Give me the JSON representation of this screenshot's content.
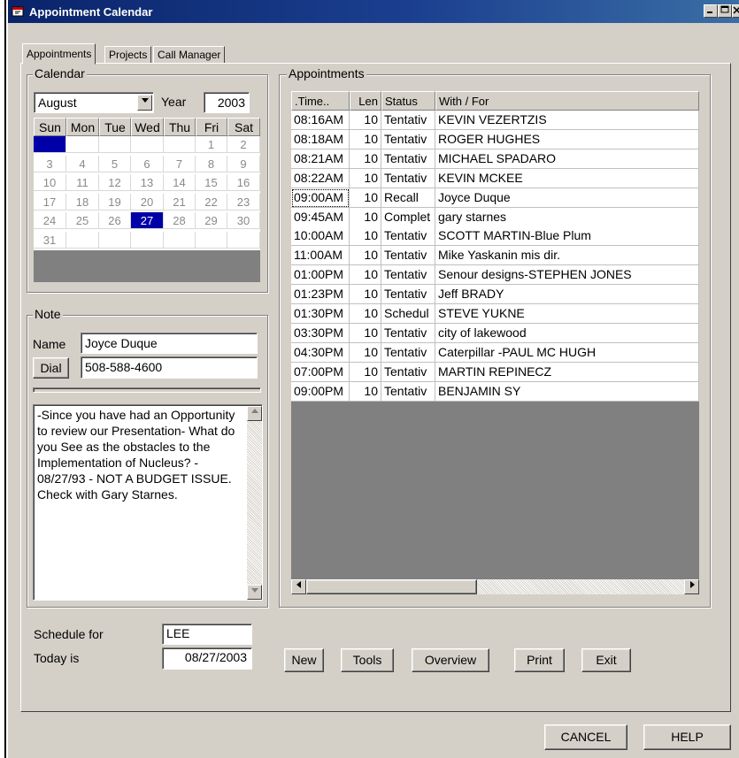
{
  "window": {
    "title": "Appointment Calendar"
  },
  "tabs": [
    {
      "label": "Appointments"
    },
    {
      "label": "Projects"
    },
    {
      "label": "Call Manager"
    }
  ],
  "calendar": {
    "group_label": "Calendar",
    "month": "August",
    "year_label": "Year",
    "year": "2003",
    "weekdays": [
      "Sun",
      "Mon",
      "Tue",
      "Wed",
      "Thu",
      "Fri",
      "Sat"
    ],
    "days": [
      [
        "",
        "",
        "",
        "",
        "",
        "1",
        "2"
      ],
      [
        "3",
        "4",
        "5",
        "6",
        "7",
        "8",
        "9"
      ],
      [
        "10",
        "11",
        "12",
        "13",
        "14",
        "15",
        "16"
      ],
      [
        "17",
        "18",
        "19",
        "20",
        "21",
        "22",
        "23"
      ],
      [
        "24",
        "25",
        "26",
        "27",
        "28",
        "29",
        "30"
      ],
      [
        "31",
        "",
        "",
        "",
        "",
        "",
        ""
      ]
    ],
    "selected_day": "27"
  },
  "note": {
    "group_label": "Note",
    "name_label": "Name",
    "name": "Joyce Duque",
    "dial_label": "Dial",
    "phone": "508-588-4600",
    "text": "-Since you have had an Opportunity to review our Presentation- What do you See as the obstacles to the Implementation of Nucleus? - 08/27/93 - NOT A BUDGET ISSUE. Check with Gary Starnes."
  },
  "appointments": {
    "group_label": "Appointments",
    "columns": [
      ".Time..",
      "Len",
      "Status",
      "With / For"
    ],
    "rows": [
      [
        "08:16AM",
        "10",
        "Tentativ",
        "KEVIN VEZERTZIS"
      ],
      [
        "08:18AM",
        "10",
        "Tentativ",
        "ROGER HUGHES"
      ],
      [
        "08:21AM",
        "10",
        "Tentativ",
        "MICHAEL SPADARO"
      ],
      [
        "08:22AM",
        "10",
        "Tentativ",
        "KEVIN MCKEE"
      ],
      [
        "09:00AM",
        "10",
        "Recall",
        "Joyce Duque"
      ],
      [
        "09:45AM",
        "10",
        "Complet",
        "gary starnes"
      ],
      [
        "10:00AM",
        "10",
        "Tentativ",
        "SCOTT MARTIN-Blue Plum"
      ],
      [
        "11:00AM",
        "10",
        "Tentativ",
        "Mike Yaskanin mis dir."
      ],
      [
        "01:00PM",
        "10",
        "Tentativ",
        "Senour designs-STEPHEN JONES"
      ],
      [
        "01:23PM",
        "10",
        "Tentativ",
        "Jeff BRADY"
      ],
      [
        "01:30PM",
        "10",
        "Schedul",
        "STEVE YUKNE"
      ],
      [
        "03:30PM",
        "10",
        "Tentativ",
        "city of lakewood"
      ],
      [
        "04:30PM",
        "10",
        "Tentativ",
        "Caterpillar -PAUL MC HUGH"
      ],
      [
        "07:00PM",
        "10",
        "Tentativ",
        "MARTIN REPINECZ"
      ],
      [
        "09:00PM",
        "10",
        "Tentativ",
        "BENJAMIN SY"
      ]
    ],
    "focused_row": 4
  },
  "footer": {
    "schedule_for_label": "Schedule for",
    "schedule_for": "LEE",
    "today_label": "Today is",
    "today": "08/27/2003",
    "buttons": {
      "new": "New",
      "tools": "Tools",
      "overview": "Overview",
      "print": "Print",
      "exit": "Exit"
    }
  },
  "dialog": {
    "cancel": "CANCEL",
    "help": "HELP"
  },
  "colors": {
    "title_bar": "#0a246a",
    "face": "#d4d0c8",
    "selection": "#0000a8"
  }
}
